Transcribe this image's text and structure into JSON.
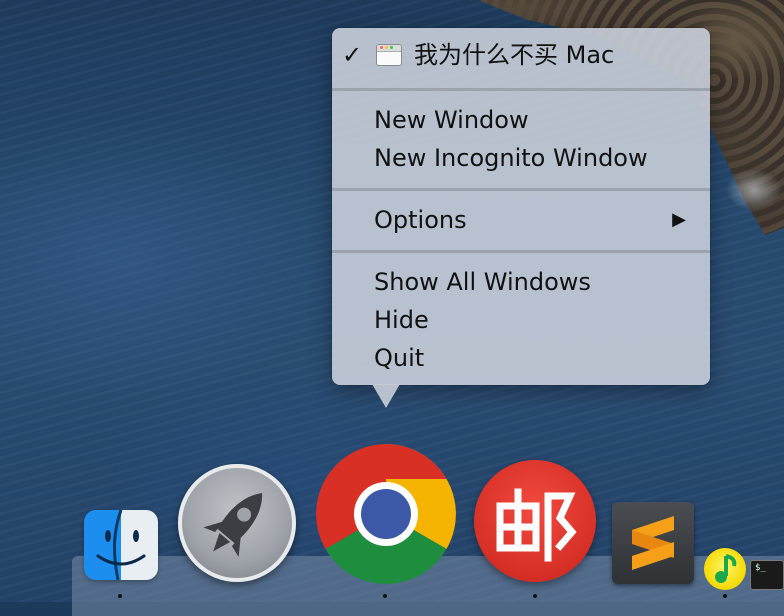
{
  "menu": {
    "window_item": {
      "checked": true,
      "check_glyph": "✓",
      "icon": "browser-window-icon",
      "title": "我为什么不买 Mac"
    },
    "items_group1": [
      "New Window",
      "New Incognito Window"
    ],
    "options": {
      "label": "Options",
      "submenu_glyph": "▶"
    },
    "items_group3": [
      "Show All Windows",
      "Hide",
      "Quit"
    ]
  },
  "dock": {
    "apps": [
      {
        "name": "Finder",
        "icon": "finder-icon",
        "running": true
      },
      {
        "name": "Launchpad",
        "icon": "launchpad-rocket-icon",
        "running": false
      },
      {
        "name": "Google Chrome",
        "icon": "chrome-icon",
        "running": true
      },
      {
        "name": "NetEase Mail Master",
        "icon": "netease-mail-icon",
        "running": true
      },
      {
        "name": "Sublime Text",
        "icon": "sublime-text-icon",
        "running": false
      },
      {
        "name": "QQ Music",
        "icon": "qq-music-icon",
        "running": true
      },
      {
        "name": "Terminal",
        "icon": "terminal-icon",
        "running": false
      }
    ],
    "terminal_prompt": "$_"
  },
  "colors": {
    "menu_bg": "#c4cad6",
    "chrome_red": "#d93025",
    "chrome_yellow": "#f4b400",
    "chrome_green": "#1e8e3e",
    "chrome_blue": "#3c59a8",
    "mail_red": "#e03a30",
    "sublime_orange": "#f6a01a"
  }
}
